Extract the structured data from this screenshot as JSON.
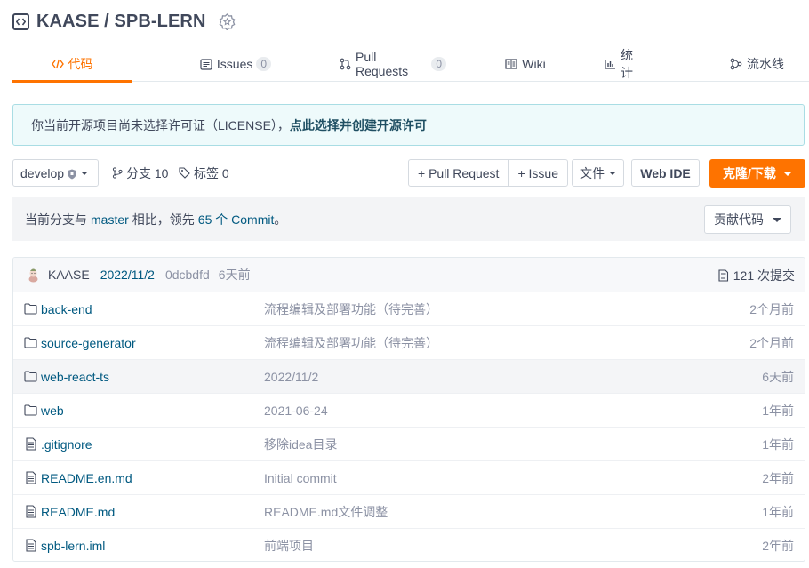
{
  "repo": {
    "title": "KAASE / SPB-LERN",
    "icon": "code-bracket-icon",
    "badge_icon": "award-badge-icon"
  },
  "tabs": [
    {
      "label": "代码",
      "icon": "code-icon",
      "active": true
    },
    {
      "label": "Issues",
      "icon": "issues-icon",
      "count": "0"
    },
    {
      "label": "Pull Requests",
      "icon": "pull-request-icon",
      "count": "0"
    },
    {
      "label": "Wiki",
      "icon": "wiki-icon"
    },
    {
      "label": "统计",
      "icon": "stats-icon"
    },
    {
      "label": "流水线",
      "icon": "pipeline-icon"
    }
  ],
  "license_banner": {
    "text": "你当前开源项目尚未选择许可证（LICENSE），",
    "link": "点此选择并创建开源许可"
  },
  "toolbar": {
    "branch": "develop",
    "branches_label": "分支 10",
    "tags_label": "标签 0",
    "pull_request_btn": "+ Pull Request",
    "issue_btn": "+ Issue",
    "file_btn": "文件",
    "webide_btn": "Web IDE",
    "clone_btn": "克隆/下载"
  },
  "compare": {
    "prefix": "当前分支与",
    "branch": "master",
    "middle": "相比，领先",
    "commits": "65 个 Commit",
    "suffix": "。",
    "contribute_btn": "贡献代码"
  },
  "last_commit": {
    "author": "KAASE",
    "date": "2022/11/2",
    "hash": "0dcbdfd",
    "ago": "6天前",
    "commit_count": "121 次提交"
  },
  "files": [
    {
      "type": "folder",
      "name": "back-end",
      "message": "流程编辑及部署功能（待完善）",
      "time": "2个月前"
    },
    {
      "type": "folder",
      "name": "source-generator",
      "message": "流程编辑及部署功能（待完善）",
      "time": "2个月前"
    },
    {
      "type": "folder",
      "name": "web-react-ts",
      "message": "2022/11/2",
      "time": "6天前"
    },
    {
      "type": "folder",
      "name": "web",
      "message": "2021-06-24",
      "time": "1年前"
    },
    {
      "type": "file",
      "name": ".gitignore",
      "message": "移除idea目录",
      "time": "1年前"
    },
    {
      "type": "file",
      "name": "README.en.md",
      "message": "Initial commit",
      "time": "2年前"
    },
    {
      "type": "file",
      "name": "README.md",
      "message": "README.md文件调整",
      "time": "1年前"
    },
    {
      "type": "file",
      "name": "spb-lern.iml",
      "message": "前端项目",
      "time": "2年前"
    }
  ],
  "colors": {
    "accent": "#fe7300",
    "link": "#005980",
    "muted": "#8c92a4"
  }
}
